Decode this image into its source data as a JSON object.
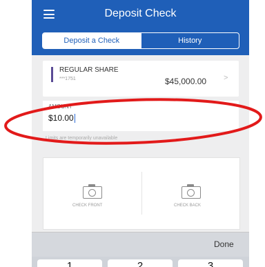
{
  "header": {
    "title": "Deposit Check"
  },
  "tabs": [
    {
      "label": "Deposit a Check",
      "active": true
    },
    {
      "label": "History",
      "active": false
    }
  ],
  "account": {
    "name": "REGULAR SHARE",
    "number": "***1751",
    "balance": "$45,000.00"
  },
  "amount": {
    "label": "AMOUNT",
    "value": "$10.00"
  },
  "limits_text": "Limits are temporarily unavailable",
  "photos": {
    "front_label": "CHECK FRONT",
    "back_label": "CHECK BACK"
  },
  "keyboard": {
    "done_label": "Done",
    "keys": [
      "1",
      "2",
      "3"
    ]
  },
  "colors": {
    "header_blue": "#1f5fb8",
    "account_accent": "#5a4b95",
    "annotation_red": "#e21a1a"
  },
  "icons": [
    "menu-icon",
    "chevron-right-icon",
    "camera-icon"
  ]
}
